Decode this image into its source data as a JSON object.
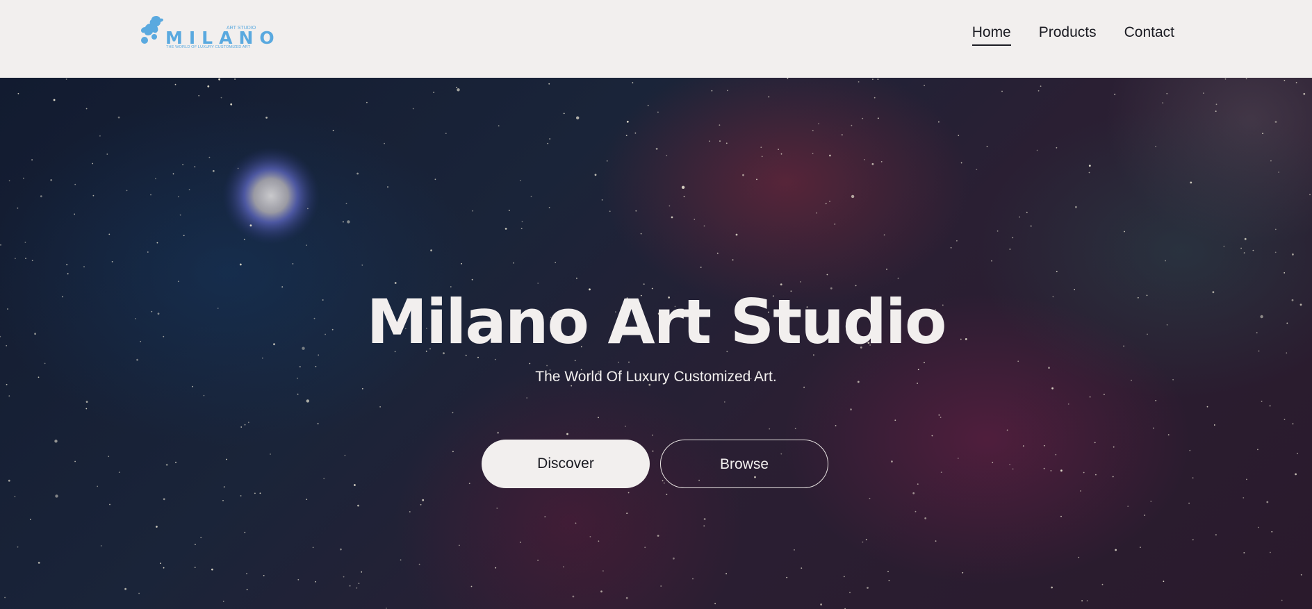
{
  "header": {
    "logo": {
      "tag": "ART STUDIO",
      "word": "MILANO",
      "subtitle": "THE WORLD OF LUXURY CUSTOMIZED ART",
      "color": "#5aa9df",
      "icon": "dog-silhouette-icon"
    },
    "nav": [
      {
        "label": "Home",
        "active": true
      },
      {
        "label": "Products",
        "active": false
      },
      {
        "label": "Contact",
        "active": false
      }
    ],
    "background": "#f2efee"
  },
  "hero": {
    "background": "galaxy-starfield-image",
    "title": "Milano Art Studio",
    "subtitle": "The World Of Luxury Customized Art.",
    "buttons": {
      "primary_label": "Discover",
      "secondary_label": "Browse"
    },
    "text_color": "#f2efee"
  }
}
